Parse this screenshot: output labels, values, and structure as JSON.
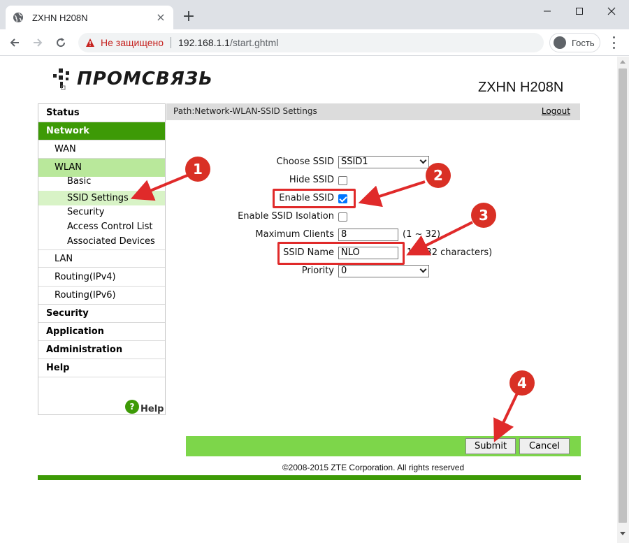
{
  "browser": {
    "tab_title": "ZXHN H208N",
    "close_glyph": "×",
    "newtab_glyph": "+",
    "not_secure": "Не защищено",
    "url_host": "192.168.1.1",
    "url_path": "/start.ghtml",
    "profile_label": "Гость",
    "window_controls": [
      "minimize",
      "maximize",
      "close"
    ]
  },
  "header": {
    "brand": "ПРОМСВЯЗЬ",
    "model": "ZXHN H208N"
  },
  "nav": {
    "status": "Status",
    "network": "Network",
    "wan": "WAN",
    "wlan": "WLAN",
    "wlan_sub": [
      "Basic",
      "SSID Settings",
      "Security",
      "Access Control List",
      "Associated Devices"
    ],
    "lan": "LAN",
    "routing_v4": "Routing(IPv4)",
    "routing_v6": "Routing(IPv6)",
    "security": "Security",
    "application": "Application",
    "administration": "Administration",
    "help": "Help",
    "help_bottom": "Help",
    "help_icon_glyph": "?"
  },
  "path": {
    "text": "Path:Network-WLAN-SSID Settings",
    "logout": "Logout"
  },
  "form": {
    "choose_ssid_label": "Choose SSID",
    "choose_ssid_value": "SSID1",
    "hide_ssid_label": "Hide SSID",
    "hide_ssid_checked": false,
    "enable_ssid_label": "Enable SSID",
    "enable_ssid_checked": true,
    "isolation_label": "Enable SSID Isolation",
    "isolation_checked": false,
    "max_clients_label": "Maximum Clients",
    "max_clients_value": "8",
    "max_clients_hint": "(1 ~ 32)",
    "ssid_name_label": "SSID Name",
    "ssid_name_value": "NLO",
    "ssid_name_hint": "1 ~ 32 characters)",
    "priority_label": "Priority",
    "priority_value": "0"
  },
  "buttons": {
    "submit": "Submit",
    "cancel": "Cancel"
  },
  "footer": {
    "copyright": "©2008-2015 ZTE Corporation. All rights reserved"
  },
  "annotations": {
    "badges": [
      "1",
      "2",
      "3",
      "4"
    ],
    "color": "#d93025"
  },
  "colors": {
    "brand_green": "#3d9a06",
    "bar_green": "#7dd64a",
    "annotation_red": "#e02a2a"
  }
}
